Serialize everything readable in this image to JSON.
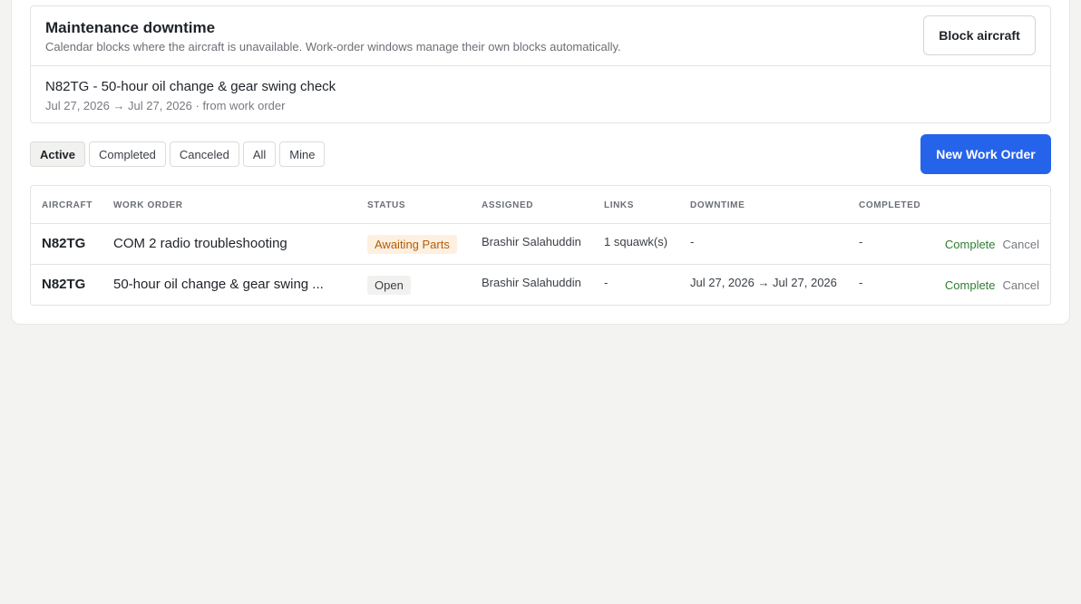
{
  "downtime": {
    "title": "Maintenance downtime",
    "subtitle": "Calendar blocks where the aircraft is unavailable. Work-order windows manage their own blocks automatically.",
    "block_button": "Block aircraft",
    "entries": [
      {
        "title": "N82TG - 50-hour oil change & gear swing check",
        "meta": "Jul 27, 2026 → Jul 27, 2026 · from work order"
      }
    ]
  },
  "filters": {
    "items": [
      "Active",
      "Completed",
      "Canceled",
      "All",
      "Mine"
    ],
    "selected": "Active"
  },
  "new_work_order_button": "New Work Order",
  "table": {
    "headers": {
      "aircraft": "Aircraft",
      "work_order": "Work Order",
      "status": "Status",
      "assigned": "Assigned",
      "links": "Links",
      "downtime": "Downtime",
      "completed": "Completed"
    },
    "rows": [
      {
        "aircraft": "N82TG",
        "work_order": "COM 2 radio troubleshooting",
        "status": "Awaiting Parts",
        "assigned": "Brashir Salahuddin",
        "links": "1 squawk(s)",
        "downtime": "-",
        "completed": "-",
        "complete_action": "Complete",
        "cancel_action": "Cancel"
      },
      {
        "aircraft": "N82TG",
        "work_order": "50-hour oil change & gear swing ...",
        "status": "Open",
        "assigned": "Brashir Salahuddin",
        "links": "-",
        "downtime": "Jul 27, 2026 → Jul 27, 2026",
        "completed": "-",
        "complete_action": "Complete",
        "cancel_action": "Cancel"
      }
    ]
  },
  "colors": {
    "accent": "#2563eb",
    "status_awaiting_bg": "#fdf0e1",
    "status_awaiting_fg": "#b35c0a",
    "action_complete": "#2f7d32"
  }
}
